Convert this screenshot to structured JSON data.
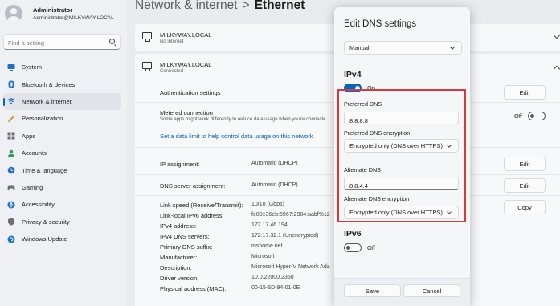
{
  "profile": {
    "name": "Administrator",
    "email": "Administrator@MILKYWAY.LOCAL"
  },
  "search": {
    "placeholder": "Find a setting"
  },
  "sidebar": {
    "items": [
      {
        "label": "System",
        "icon": "monitor-icon",
        "color": "#1f6fc4"
      },
      {
        "label": "Bluetooth & devices",
        "icon": "bluetooth-icon",
        "color": "#1f6fc4"
      },
      {
        "label": "Network & internet",
        "icon": "wifi-icon",
        "color": "#1f6fc4",
        "active": true
      },
      {
        "label": "Personalization",
        "icon": "brush-icon",
        "color": "#e0892a"
      },
      {
        "label": "Apps",
        "icon": "apps-icon",
        "color": "#6b6f76"
      },
      {
        "label": "Accounts",
        "icon": "person-icon",
        "color": "#2f9e5b"
      },
      {
        "label": "Time & language",
        "icon": "globe-clock-icon",
        "color": "#1f6fc4"
      },
      {
        "label": "Gaming",
        "icon": "controller-icon",
        "color": "#6b6f76"
      },
      {
        "label": "Accessibility",
        "icon": "accessibility-icon",
        "color": "#1f6fc4"
      },
      {
        "label": "Privacy & security",
        "icon": "shield-icon",
        "color": "#6b6f76"
      },
      {
        "label": "Windows Update",
        "icon": "update-icon",
        "color": "#1f6fc4"
      }
    ]
  },
  "breadcrumb": {
    "parent": "Network & internet",
    "separator": ">",
    "current": "Ethernet"
  },
  "network1": {
    "name": "MILKYWAY.LOCAL",
    "status": "No internet"
  },
  "network2": {
    "name": "MILKYWAY.LOCAL",
    "status": "Connected"
  },
  "settings": {
    "auth_label": "Authentication settings",
    "auth_button": "Edit",
    "metered_label": "Metered connection",
    "metered_sub": "Some apps might work differently to reduce data usage when you're connecte",
    "metered_state": "Off",
    "data_limit_link": "Set a data limit to help control data usage on this network",
    "ip_assignment_label": "IP assignment:",
    "ip_assignment_value": "Automatic (DHCP)",
    "ip_edit": "Edit",
    "dns_assignment_label": "DNS server assignment:",
    "dns_assignment_value": "Automatic (DHCP)",
    "dns_edit": "Edit",
    "copy_button": "Copy",
    "details": [
      {
        "label": "Link speed (Receive/Transmit):",
        "value": "10/10 (Gbps)"
      },
      {
        "label": "Link-local IPv6 address:",
        "value": "fe80::36eb:5967:2984:aabf%12"
      },
      {
        "label": "IPv4 address:",
        "value": "172.17.46.194"
      },
      {
        "label": "IPv4 DNS servers:",
        "value": "172.17.32.1 (Unencrypted)"
      },
      {
        "label": "Primary DNS suffix:",
        "value": "mshome.net"
      },
      {
        "label": "Manufacturer:",
        "value": "Microsoft"
      },
      {
        "label": "Description:",
        "value": "Microsoft Hyper-V Network Ada"
      },
      {
        "label": "Driver version:",
        "value": "10.0.22000.2360"
      },
      {
        "label": "Physical address (MAC):",
        "value": "00-15-5D-94-01-0E"
      }
    ]
  },
  "dialog": {
    "title": "Edit DNS settings",
    "mode": "Manual",
    "ipv4": {
      "heading": "IPv4",
      "toggle_state": "On",
      "preferred_label": "Preferred DNS",
      "preferred_value": "8.8.8.8",
      "preferred_enc_label": "Preferred DNS encryption",
      "preferred_enc_value": "Encrypted only (DNS over HTTPS)",
      "alternate_label": "Alternate DNS",
      "alternate_value": "8.8.4.4",
      "alternate_enc_label": "Alternate DNS encryption",
      "alternate_enc_value": "Encrypted only (DNS over HTTPS)"
    },
    "ipv6": {
      "heading": "IPv6",
      "toggle_state": "Off"
    },
    "save": "Save",
    "cancel": "Cancel",
    "highlight_color": "#d83a3a",
    "accent": "#0067c0"
  }
}
